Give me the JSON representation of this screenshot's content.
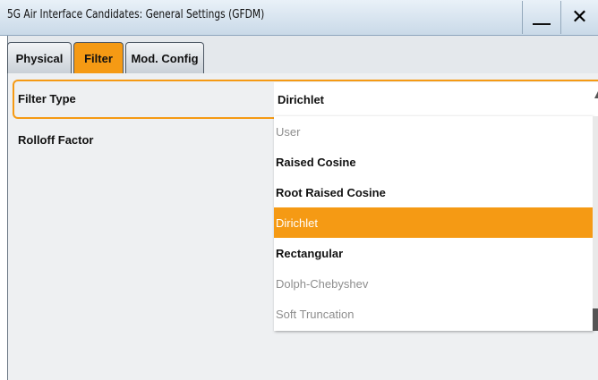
{
  "window": {
    "title": "5G Air Interface Candidates: General Settings (GFDM)",
    "minimize_icon": "minimize-icon",
    "close_icon": "close-icon",
    "close_glyph": "✕"
  },
  "tabs": [
    {
      "label": "Physical",
      "active": false
    },
    {
      "label": "Filter",
      "active": true
    },
    {
      "label": "Mod. Config",
      "active": false
    }
  ],
  "form": {
    "filter_type_label": "Filter Type",
    "filter_type_value": "Dirichlet",
    "rolloff_label": "Rolloff Factor"
  },
  "dropdown_options": [
    {
      "label": "User",
      "state": "disabled"
    },
    {
      "label": "Raised Cosine",
      "state": "enabled"
    },
    {
      "label": "Root Raised Cosine",
      "state": "enabled"
    },
    {
      "label": "Dirichlet",
      "state": "selected"
    },
    {
      "label": "Rectangular",
      "state": "enabled"
    },
    {
      "label": "Dolph-Chebyshev",
      "state": "disabled"
    },
    {
      "label": "Soft Truncation",
      "state": "disabled"
    }
  ],
  "colors": {
    "accent": "#f59a14",
    "titlebar": "#d6e3ef",
    "disabled_text": "#8e8e8e"
  }
}
